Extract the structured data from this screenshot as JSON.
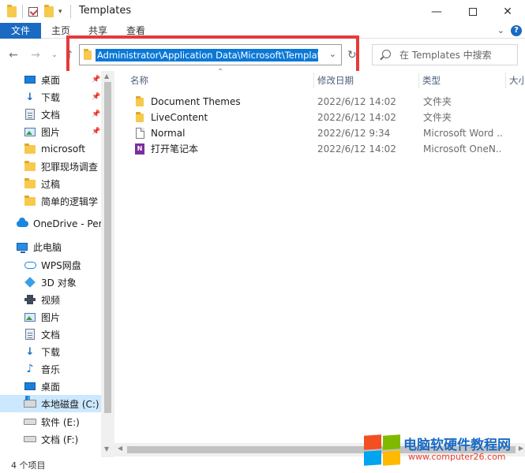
{
  "window": {
    "title": "Templates"
  },
  "ribbon": {
    "tabs": [
      "文件",
      "主页",
      "共享",
      "查看"
    ]
  },
  "address": {
    "path": "Administrator\\Application Data\\Microsoft\\Templates"
  },
  "search": {
    "placeholder": "在 Templates 中搜索"
  },
  "colors": {
    "accent": "#1a6ac2",
    "highlight": "#e53a3a",
    "selected": "#cce8ff"
  },
  "sidebar": {
    "items": [
      {
        "label": "桌面",
        "icon": "desktop-icon"
      },
      {
        "label": "下载",
        "icon": "download-icon"
      },
      {
        "label": "文档",
        "icon": "document-icon"
      },
      {
        "label": "图片",
        "icon": "picture-icon"
      },
      {
        "label": "microsoft",
        "icon": "folder-icon"
      },
      {
        "label": "犯罪现场调查",
        "icon": "folder-icon"
      },
      {
        "label": "过稿",
        "icon": "folder-icon"
      },
      {
        "label": "简单的逻辑学",
        "icon": "folder-icon"
      },
      {
        "label": "OneDrive - Perso",
        "icon": "onedrive-icon"
      },
      {
        "label": "此电脑",
        "icon": "this-pc-icon"
      },
      {
        "label": "WPS网盘",
        "icon": "wps-cloud-icon"
      },
      {
        "label": "3D 对象",
        "icon": "3d-objects-icon"
      },
      {
        "label": "视频",
        "icon": "video-icon"
      },
      {
        "label": "图片",
        "icon": "picture-icon"
      },
      {
        "label": "文档",
        "icon": "document-icon"
      },
      {
        "label": "下载",
        "icon": "download-icon"
      },
      {
        "label": "音乐",
        "icon": "music-icon"
      },
      {
        "label": "桌面",
        "icon": "desktop-icon"
      },
      {
        "label": "本地磁盘 (C:)",
        "icon": "drive-c-icon"
      },
      {
        "label": "软件 (E:)",
        "icon": "drive-icon"
      },
      {
        "label": "文档 (F:)",
        "icon": "drive-icon"
      }
    ]
  },
  "columns": {
    "name": "名称",
    "date": "修改日期",
    "type": "类型",
    "size": "大小"
  },
  "files": [
    {
      "name": "Document Themes",
      "date": "2022/6/12 14:02",
      "type": "文件夹",
      "icon": "folder-icon"
    },
    {
      "name": "LiveContent",
      "date": "2022/6/12 14:02",
      "type": "文件夹",
      "icon": "folder-icon"
    },
    {
      "name": "Normal",
      "date": "2022/6/12 9:34",
      "type": "Microsoft Word ...",
      "icon": "word-template-icon"
    },
    {
      "name": "打开笔记本",
      "date": "2022/6/12 14:02",
      "type": "Microsoft OneN...",
      "icon": "onenote-icon"
    }
  ],
  "status": {
    "count": "4 个项目"
  },
  "watermark": {
    "title": "电脑软硬件教程网",
    "url": "www.computer26.com"
  }
}
